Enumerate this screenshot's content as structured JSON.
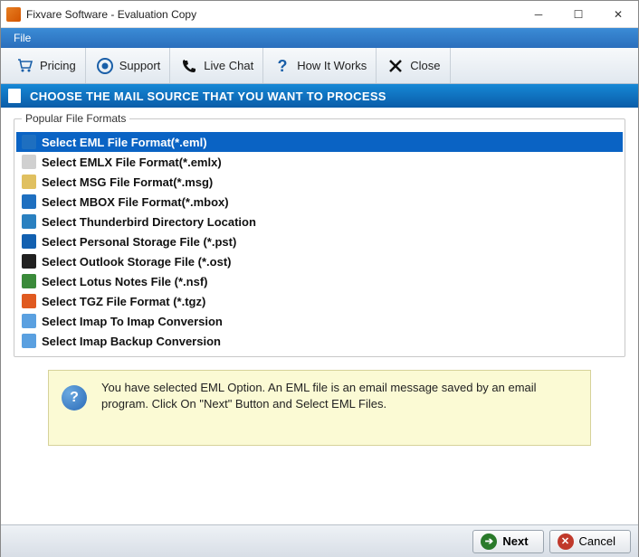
{
  "window": {
    "title": "Fixvare Software - Evaluation Copy"
  },
  "menubar": {
    "file": "File"
  },
  "toolbar": {
    "pricing": "Pricing",
    "support": "Support",
    "livechat": "Live Chat",
    "howitworks": "How It Works",
    "close": "Close"
  },
  "section_header": "CHOOSE THE MAIL SOURCE THAT YOU WANT TO PROCESS",
  "group_label": "Popular File Formats",
  "formats": [
    {
      "label": "Select EML File Format(*.eml)",
      "color": "#1e6fc0",
      "selected": true
    },
    {
      "label": "Select EMLX File Format(*.emlx)",
      "color": "#d0d0d0",
      "selected": false
    },
    {
      "label": "Select MSG File Format(*.msg)",
      "color": "#e0c060",
      "selected": false
    },
    {
      "label": "Select MBOX File Format(*.mbox)",
      "color": "#1e6fc0",
      "selected": false
    },
    {
      "label": "Select Thunderbird Directory Location",
      "color": "#2a80c0",
      "selected": false
    },
    {
      "label": "Select Personal Storage File (*.pst)",
      "color": "#1260b0",
      "selected": false
    },
    {
      "label": "Select Outlook Storage File (*.ost)",
      "color": "#202020",
      "selected": false
    },
    {
      "label": "Select Lotus Notes File (*.nsf)",
      "color": "#3a8a3a",
      "selected": false
    },
    {
      "label": "Select TGZ File Format (*.tgz)",
      "color": "#e05a20",
      "selected": false
    },
    {
      "label": "Select Imap To Imap Conversion",
      "color": "#5aa0e0",
      "selected": false
    },
    {
      "label": "Select Imap Backup Conversion",
      "color": "#5aa0e0",
      "selected": false
    }
  ],
  "info_message": "You have selected EML Option. An EML file is an email message saved by an email program. Click On \"Next\" Button and Select EML Files.",
  "footer": {
    "next": "Next",
    "cancel": "Cancel"
  }
}
